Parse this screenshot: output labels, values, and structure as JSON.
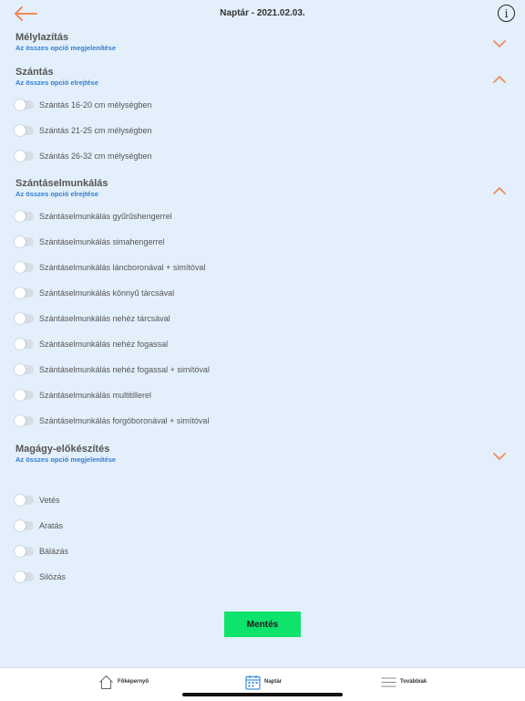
{
  "header": {
    "title": "Naptár - 2021.02.03.",
    "back_icon": "arrow-left-icon",
    "info_icon": "info-icon",
    "info_glyph": "i",
    "accent_color": "#f08a5d"
  },
  "sections": [
    {
      "title": "Mélylazítás",
      "link": "Az összes opció megjelenítése",
      "expanded": false,
      "options": []
    },
    {
      "title": "Szántás",
      "link": "Az összes opció elrejtése",
      "expanded": true,
      "options": [
        "Szántás 16-20 cm mélységben",
        "Szántás 21-25 cm mélységben",
        "Szántás 26-32 cm mélységben"
      ]
    },
    {
      "title": "Szántáselmunkálás",
      "link": "Az összes opció elrejtése",
      "expanded": true,
      "options": [
        "Szántáselmunkálás gyűrűshengerrel",
        "Szántáselmunkálás simahengerrel",
        "Szántáselmunkálás láncboronával + simítóval",
        "Szántáselmunkálás könnyű tárcsával",
        "Szántáselmunkálás nehéz tárcsával",
        "Szántáselmunkálás nehéz fogassal",
        "Szántáselmunkálás nehéz fogassal + simítóval",
        "Szántáselmunkálás multitillerel",
        "Szántáselmunkálás forgóboronával + simítóval"
      ]
    },
    {
      "title": "Magágy-előkészítés",
      "link": "Az összes opció megjelenítése",
      "expanded": false,
      "options": []
    }
  ],
  "standalone_options": [
    "Vetés",
    "Aratás",
    "Bálázás",
    "Silózás"
  ],
  "save_label": "Mentés",
  "save_color": "#0ee36c",
  "tabbar": {
    "home": "Főképernyő",
    "calendar": "Naptár",
    "more": "Továbbiak"
  }
}
